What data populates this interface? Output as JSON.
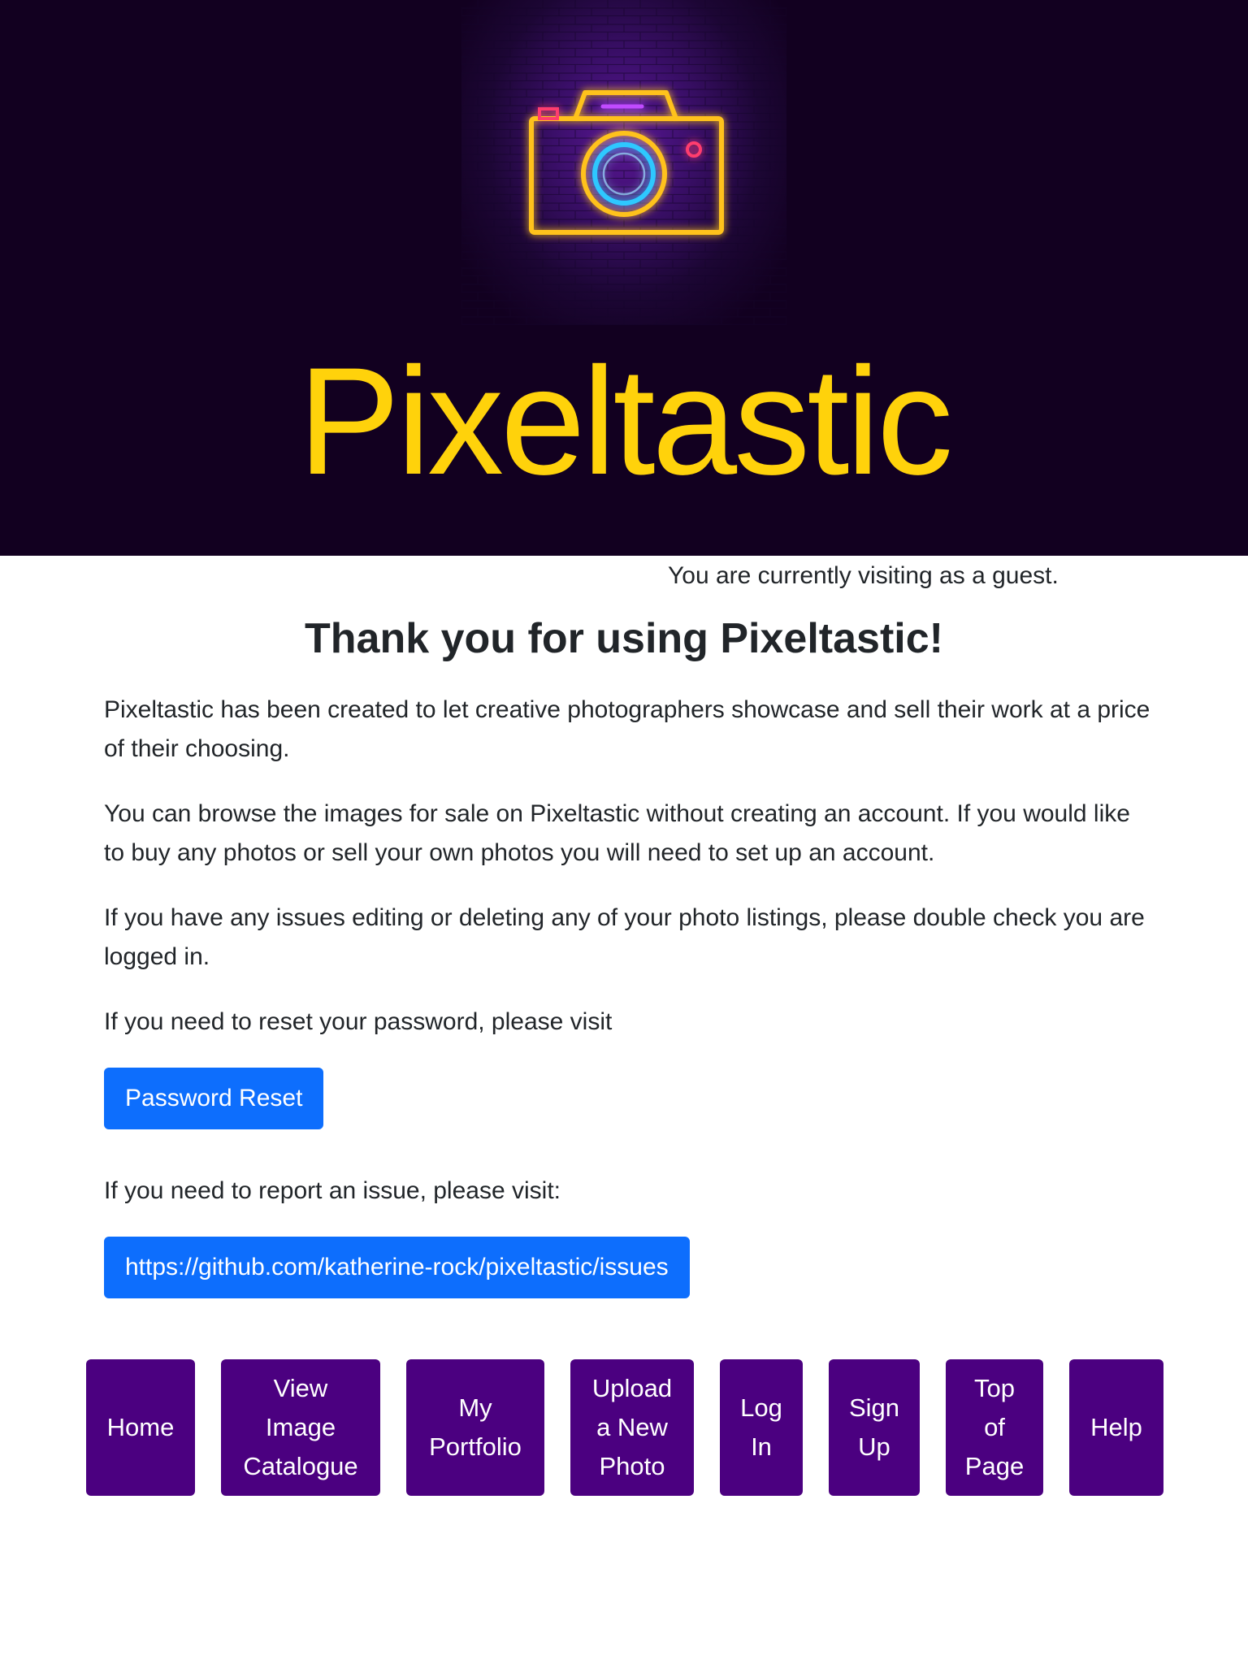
{
  "header": {
    "logo_icon": "neon-camera-icon",
    "title": "Pixeltastic",
    "title_color": "#ffd20b",
    "background": "#120020"
  },
  "status": {
    "guest_text": "You are currently visiting as a guest."
  },
  "main": {
    "heading": "Thank you for using Pixeltastic!",
    "paragraphs": [
      "Pixeltastic has been created to let creative photographers showcase and sell their work at a price of their choosing.",
      "You can browse the images for sale on Pixeltastic without creating an account. If you would like to buy any photos or sell your own photos you will need to set up an account.",
      "If you have any issues editing or deleting any of your photo listings, please double check you are logged in.",
      "If you need to reset your password, please visit"
    ],
    "password_reset_label": "Password Reset",
    "report_text": "If you need to report an issue, please visit:",
    "issues_link_label": "https://github.com/katherine-rock/pixeltastic/issues",
    "button_color": "#0d6efd"
  },
  "nav": {
    "button_color": "#4b0080",
    "items": [
      {
        "lines": [
          "Home"
        ]
      },
      {
        "lines": [
          "View",
          "Image",
          "Catalogue"
        ]
      },
      {
        "lines": [
          "My",
          "Portfolio"
        ]
      },
      {
        "lines": [
          "Upload",
          "a New",
          "Photo"
        ]
      },
      {
        "lines": [
          "Log",
          "In"
        ]
      },
      {
        "lines": [
          "Sign",
          "Up"
        ]
      },
      {
        "lines": [
          "Top",
          "of",
          "Page"
        ]
      },
      {
        "lines": [
          "Help"
        ]
      }
    ]
  }
}
